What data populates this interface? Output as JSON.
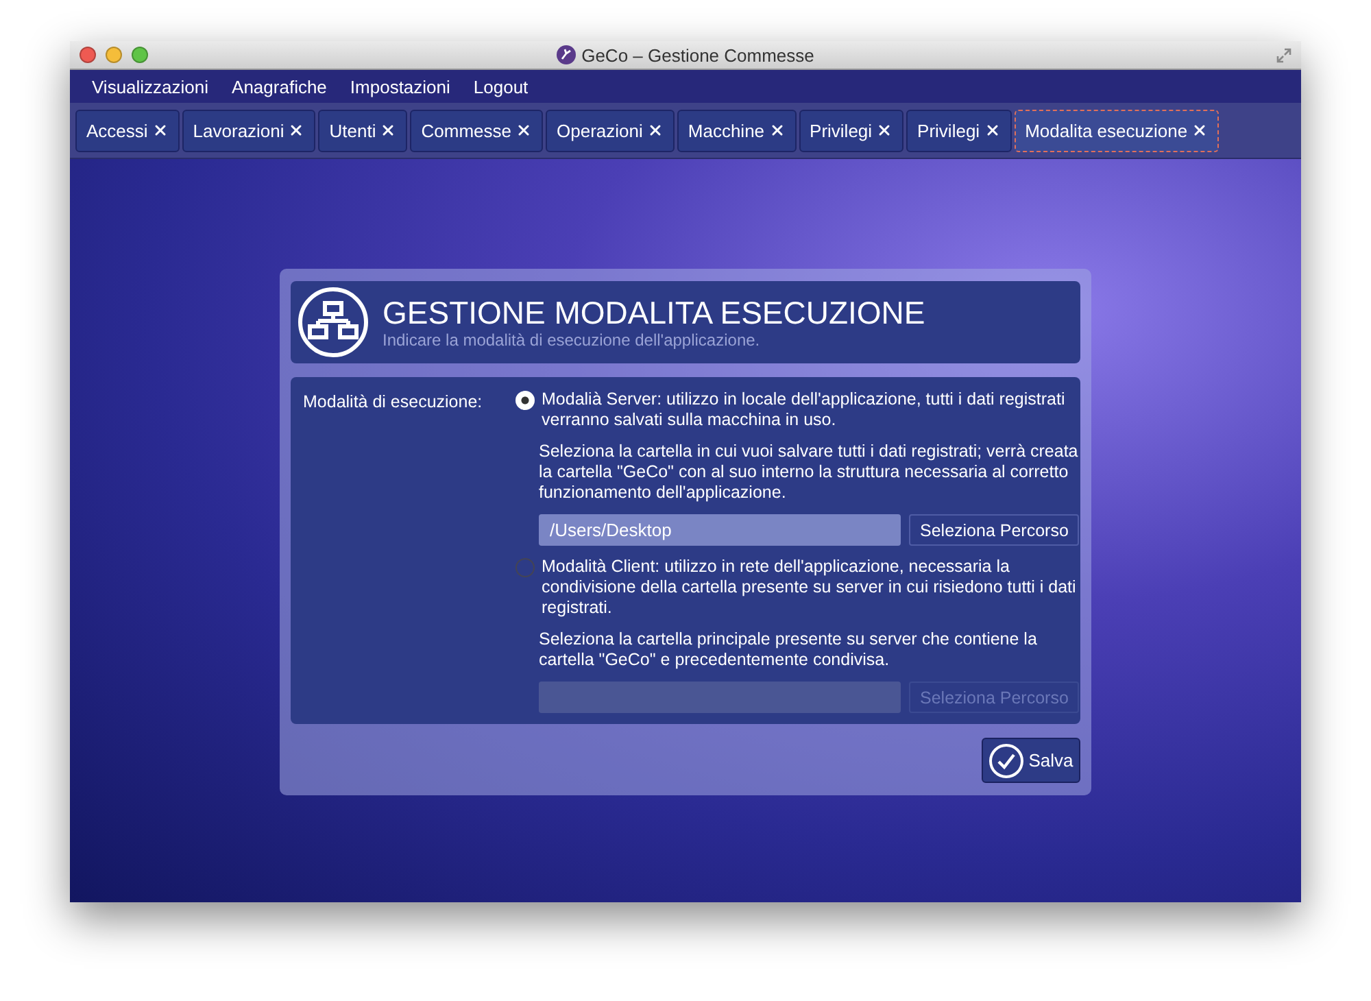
{
  "window": {
    "title": "GeCo – Gestione Commesse"
  },
  "menu": [
    "Visualizzazioni",
    "Anagrafiche",
    "Impostazioni",
    "Logout"
  ],
  "tabs": [
    {
      "label": "Accessi",
      "selected": false
    },
    {
      "label": "Lavorazioni",
      "selected": false
    },
    {
      "label": "Utenti",
      "selected": false
    },
    {
      "label": "Commesse",
      "selected": false
    },
    {
      "label": "Operazioni",
      "selected": false
    },
    {
      "label": "Macchine",
      "selected": false
    },
    {
      "label": "Privilegi",
      "selected": false
    },
    {
      "label": "Privilegi",
      "selected": false
    },
    {
      "label": "Modalita esecuzione",
      "selected": true
    }
  ],
  "dialog": {
    "title": "GESTIONE MODALITA ESECUZIONE",
    "subtitle": "Indicare la modalità di esecuzione dell'applicazione.",
    "field_label": "Modalità di esecuzione:",
    "options": [
      {
        "label": "Modalià Server: utilizzo in locale dell'applicazione, tutti i dati registrati verranno salvati sulla macchina in uso.",
        "selected": true,
        "note": "Seleziona la cartella in cui vuoi salvare tutti i dati registrati; verrà creata la cartella \"GeCo\" con al suo interno la struttura necessaria al corretto funzionamento dell'applicazione.",
        "path": "/Users/Desktop",
        "button": "Seleziona Percorso",
        "disabled": false
      },
      {
        "label": "Modalità Client: utilizzo in rete dell'applicazione, necessaria la condivisione della cartella presente su server in cui risiedono tutti i dati registrati.",
        "selected": false,
        "note": "Seleziona la cartella principale presente su server che contiene la cartella \"GeCo\" e precedentemente condivisa.",
        "button": "Seleziona Percorso",
        "disabled": true
      }
    ],
    "save": "Salva"
  }
}
